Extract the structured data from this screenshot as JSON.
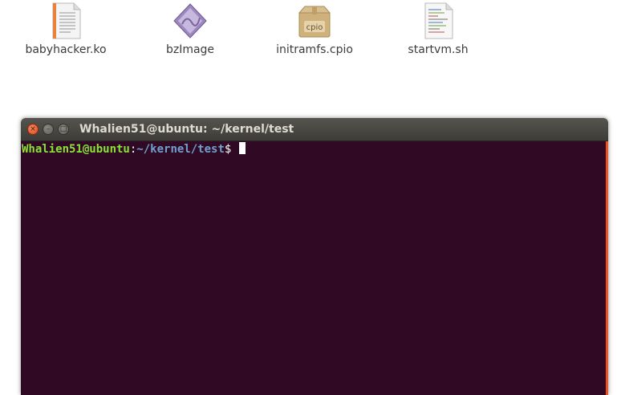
{
  "desktop": {
    "files": [
      {
        "name": "babyhacker.ko",
        "icon": "text-document-icon"
      },
      {
        "name": "bzImage",
        "icon": "binary-file-icon"
      },
      {
        "name": "initramfs.cpio",
        "icon": "archive-package-icon"
      },
      {
        "name": "startvm.sh",
        "icon": "script-file-icon"
      }
    ],
    "archive_badge": "cpio"
  },
  "terminal": {
    "title": "Whalien51@ubuntu: ~/kernel/test",
    "prompt_user_host": "Whalien51@ubuntu",
    "prompt_colon": ":",
    "prompt_path": "~/kernel/test",
    "prompt_symbol": "$ ",
    "colors": {
      "background": "#300a24",
      "user": "#8ae234",
      "path": "#729fcf",
      "accent": "#e95420"
    },
    "buttons": {
      "close": "×",
      "minimize": "–",
      "maximize": "□"
    }
  }
}
